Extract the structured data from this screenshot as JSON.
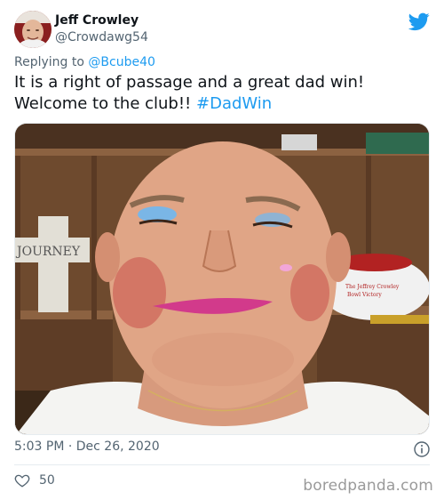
{
  "author": {
    "display_name": "Jeff Crowley",
    "handle": "@Crowdawg54"
  },
  "reply": {
    "prefix": "Replying to ",
    "mention": "@Bcube40"
  },
  "tweet": {
    "text": "It is a right of passage and a great dad win! Welcome to the club!! ",
    "hashtag": "#DadWin"
  },
  "photo": {
    "cross_text": "JOURNEY",
    "football_signature": "The Jeffrey Crowley Bowl Victory Paul Ernst Lupe"
  },
  "meta": {
    "timestamp": "5:03 PM · Dec 26, 2020",
    "like_count": "50"
  },
  "watermark": "boredpanda.com",
  "icons": {
    "brand": "twitter-bird-icon",
    "info": "info-icon",
    "like": "heart-icon"
  },
  "colors": {
    "accent": "#1d9bf0",
    "text": "#0f1419",
    "muted": "#536471"
  }
}
